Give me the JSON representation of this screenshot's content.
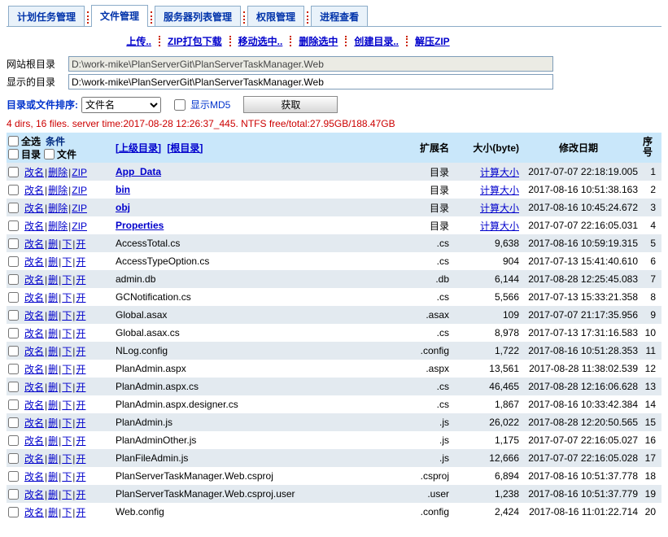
{
  "tabs": [
    {
      "label": "计划任务管理",
      "active": false
    },
    {
      "label": "文件管理",
      "active": true
    },
    {
      "label": "服务器列表管理",
      "active": false
    },
    {
      "label": "权限管理",
      "active": false
    },
    {
      "label": "进程查看",
      "active": false
    }
  ],
  "toolbar": {
    "links": [
      "上传..",
      "ZIP打包下载",
      "移动选中..",
      "删除选中",
      "创建目录..",
      "解压ZIP"
    ]
  },
  "form": {
    "root_label": "网站根目录",
    "root_value": "D:\\work-mike\\PlanServerGit\\PlanServerTaskManager.Web",
    "display_label": "显示的目录",
    "display_value": "D:\\work-mike\\PlanServerGit\\PlanServerTaskManager.Web",
    "sort_label": "目录或文件排序:",
    "sort_value": "文件名",
    "md5_label": "显示MD5",
    "fetch_button": "获取"
  },
  "status": "4 dirs, 16 files. server time:2017-08-28 12:26:37_445. NTFS free/total:27.95GB/188.47GB",
  "table": {
    "header": {
      "select_all": "全选",
      "condition": "条件",
      "dir_label": "目录",
      "file_label": "文件",
      "parent_link": "[上级目录]",
      "root_link": "[根目录]",
      "ext": "扩展名",
      "size": "大小(byte)",
      "date": "修改日期",
      "num_line1": "序",
      "num_line2": "号"
    },
    "dir_actions": [
      "改名",
      "删除",
      "ZIP"
    ],
    "file_actions": [
      "改名",
      "删",
      "下",
      "开"
    ],
    "rows": [
      {
        "type": "dir",
        "name": "App_Data",
        "ext": "目录",
        "size": "计算大小",
        "date": "2017-07-07 22:18:19.005",
        "num": "1"
      },
      {
        "type": "dir",
        "name": "bin",
        "ext": "目录",
        "size": "计算大小",
        "date": "2017-08-16 10:51:38.163",
        "num": "2"
      },
      {
        "type": "dir",
        "name": "obj",
        "ext": "目录",
        "size": "计算大小",
        "date": "2017-08-16 10:45:24.672",
        "num": "3"
      },
      {
        "type": "dir",
        "name": "Properties",
        "ext": "目录",
        "size": "计算大小",
        "date": "2017-07-07 22:16:05.031",
        "num": "4"
      },
      {
        "type": "file",
        "name": "AccessTotal.cs",
        "ext": ".cs",
        "size": "9,638",
        "date": "2017-08-16 10:59:19.315",
        "num": "5"
      },
      {
        "type": "file",
        "name": "AccessTypeOption.cs",
        "ext": ".cs",
        "size": "904",
        "date": "2017-07-13 15:41:40.610",
        "num": "6"
      },
      {
        "type": "file",
        "name": "admin.db",
        "ext": ".db",
        "size": "6,144",
        "date": "2017-08-28 12:25:45.083",
        "num": "7"
      },
      {
        "type": "file",
        "name": "GCNotification.cs",
        "ext": ".cs",
        "size": "5,566",
        "date": "2017-07-13 15:33:21.358",
        "num": "8"
      },
      {
        "type": "file",
        "name": "Global.asax",
        "ext": ".asax",
        "size": "109",
        "date": "2017-07-07 21:17:35.956",
        "num": "9"
      },
      {
        "type": "file",
        "name": "Global.asax.cs",
        "ext": ".cs",
        "size": "8,978",
        "date": "2017-07-13 17:31:16.583",
        "num": "10"
      },
      {
        "type": "file",
        "name": "NLog.config",
        "ext": ".config",
        "size": "1,722",
        "date": "2017-08-16 10:51:28.353",
        "num": "11"
      },
      {
        "type": "file",
        "name": "PlanAdmin.aspx",
        "ext": ".aspx",
        "size": "13,561",
        "date": "2017-08-28 11:38:02.539",
        "num": "12"
      },
      {
        "type": "file",
        "name": "PlanAdmin.aspx.cs",
        "ext": ".cs",
        "size": "46,465",
        "date": "2017-08-28 12:16:06.628",
        "num": "13"
      },
      {
        "type": "file",
        "name": "PlanAdmin.aspx.designer.cs",
        "ext": ".cs",
        "size": "1,867",
        "date": "2017-08-16 10:33:42.384",
        "num": "14"
      },
      {
        "type": "file",
        "name": "PlanAdmin.js",
        "ext": ".js",
        "size": "26,022",
        "date": "2017-08-28 12:20:50.565",
        "num": "15"
      },
      {
        "type": "file",
        "name": "PlanAdminOther.js",
        "ext": ".js",
        "size": "1,175",
        "date": "2017-07-07 22:16:05.027",
        "num": "16"
      },
      {
        "type": "file",
        "name": "PlanFileAdmin.js",
        "ext": ".js",
        "size": "12,666",
        "date": "2017-07-07 22:16:05.028",
        "num": "17"
      },
      {
        "type": "file",
        "name": "PlanServerTaskManager.Web.csproj",
        "ext": ".csproj",
        "size": "6,894",
        "date": "2017-08-16 10:51:37.778",
        "num": "18"
      },
      {
        "type": "file",
        "name": "PlanServerTaskManager.Web.csproj.user",
        "ext": ".user",
        "size": "1,238",
        "date": "2017-08-16 10:51:37.779",
        "num": "19"
      },
      {
        "type": "file",
        "name": "Web.config",
        "ext": ".config",
        "size": "2,424",
        "date": "2017-08-16 11:01:22.714",
        "num": "20"
      }
    ]
  }
}
